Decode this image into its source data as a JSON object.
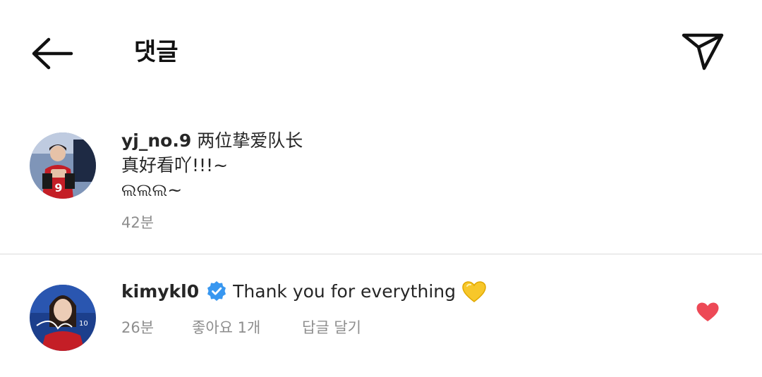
{
  "header": {
    "title": "댓글",
    "back_icon": "arrow-left-icon",
    "send_icon": "paper-plane-icon"
  },
  "comments": [
    {
      "username": "yj_no.9",
      "lines": [
        "两位挚爱队长",
        "真好看吖!!!~",
        "ଲଲଲ~"
      ],
      "time": "42분"
    },
    {
      "username": "kimykl0",
      "verified": true,
      "text": "Thank you for everything",
      "emoji": "yellow-heart-icon",
      "time": "26분",
      "likes_label": "좋아요 1개",
      "reply_label": "답글 달기",
      "liked": true,
      "like_color": "#ed4956"
    }
  ],
  "colors": {
    "verified": "#3897f0",
    "muted": "#8e8e8e",
    "divider": "#dbdbdb"
  }
}
